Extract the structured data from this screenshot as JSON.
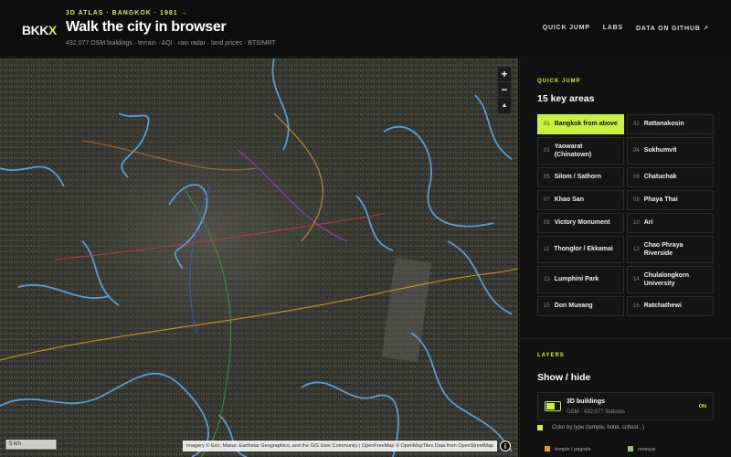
{
  "header": {
    "logo_main": "BKK",
    "logo_accent": "X",
    "kicker": "3D ATLAS · BANGKOK · 1981 →",
    "title": "Walk the city in browser",
    "subtitle": "432,077 OSM buildings · terrain · AQI · rain radar · land prices · BTS/MRT",
    "nav": [
      "QUICK JUMP",
      "LABS",
      "DATA ON GITHUB ↗"
    ]
  },
  "map": {
    "zoom_in": "+",
    "zoom_out": "−",
    "compass": "▲",
    "scale_label": "5 km",
    "attribution": "Imagery © Esri, Maxar, Earthstar Geographics, and the GIS User Community | OpenFreeMap © OpenMapTiles Data from OpenStreetMap",
    "info": "i",
    "colors": {
      "water": "#5aa9e6",
      "rail_a": "#e0a020",
      "rail_b": "#3a9a3a",
      "rail_c": "#c03a3a",
      "rail_d": "#3a5ac0",
      "rail_e": "#a040c0"
    }
  },
  "panel": {
    "quick_jump": {
      "kicker": "QUICK JUMP",
      "title": "15 key areas",
      "areas": [
        {
          "num": "01",
          "label": "Bangkok from above",
          "active": true
        },
        {
          "num": "02",
          "label": "Rattanakosin"
        },
        {
          "num": "03",
          "label": "Yaowarat (Chinatown)"
        },
        {
          "num": "04",
          "label": "Sukhumvit"
        },
        {
          "num": "05",
          "label": "Silom / Sathorn"
        },
        {
          "num": "06",
          "label": "Chatuchak"
        },
        {
          "num": "07",
          "label": "Khao San"
        },
        {
          "num": "08",
          "label": "Phaya Thai"
        },
        {
          "num": "09",
          "label": "Victory Monument"
        },
        {
          "num": "10",
          "label": "Ari"
        },
        {
          "num": "11",
          "label": "Thonglor / Ekkamai"
        },
        {
          "num": "12",
          "label": "Chao Phraya Riverside"
        },
        {
          "num": "13",
          "label": "Lumphini Park"
        },
        {
          "num": "14",
          "label": "Chulalongkorn University"
        },
        {
          "num": "15",
          "label": "Don Mueang"
        },
        {
          "num": "16",
          "label": "Ratchathewi"
        }
      ]
    },
    "layers": {
      "kicker": "LAYERS",
      "title": "Show / hide",
      "buildings": {
        "name": "3D buildings",
        "meta": "OSM · 432,077 features",
        "state": "ON",
        "option": "Color by type (temple, hotel, school...)"
      },
      "legend": [
        {
          "label": "temple / pagoda",
          "color": "#e0a020"
        },
        {
          "label": "mosque",
          "color": "#8fc870"
        }
      ]
    }
  }
}
